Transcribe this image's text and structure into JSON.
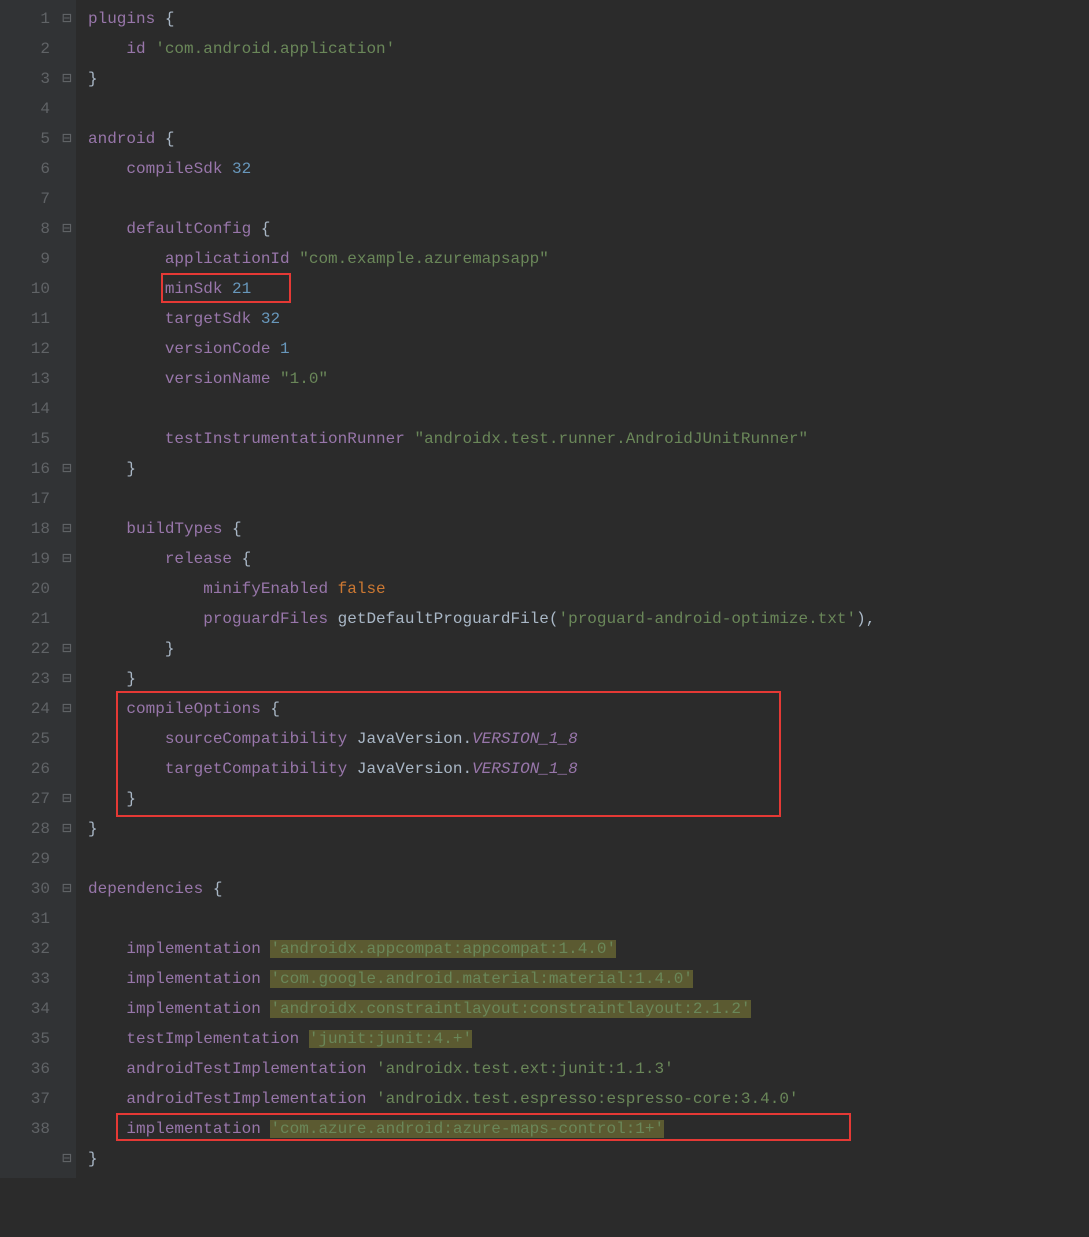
{
  "lineNumbers": [
    "1",
    "2",
    "3",
    "4",
    "5",
    "6",
    "7",
    "8",
    "9",
    "10",
    "11",
    "12",
    "13",
    "14",
    "15",
    "16",
    "17",
    "18",
    "19",
    "20",
    "21",
    "22",
    "23",
    "24",
    "25",
    "26",
    "27",
    "28",
    "29",
    "30",
    "31",
    "32",
    "33",
    "34",
    "35",
    "36",
    "37",
    "38",
    ""
  ],
  "folds": [
    "⊟",
    "",
    "⊟",
    "",
    "⊟",
    "",
    "",
    "⊟",
    "",
    "",
    "",
    "",
    "",
    "",
    "",
    "⊟",
    "",
    "⊟",
    "⊟",
    "",
    "",
    "⊟",
    "⊟",
    "⊟",
    "",
    "",
    "⊟",
    "⊟",
    "",
    "⊟",
    "",
    "",
    "",
    "",
    "",
    "",
    "",
    "",
    "⊟"
  ],
  "code": {
    "l1": {
      "m": "plugins",
      "b": " {"
    },
    "l2": {
      "indent": "    ",
      "m": "id",
      "s": " 'com.android.application'"
    },
    "l3": {
      "b": "}"
    },
    "l5": {
      "m": "android",
      "b": " {"
    },
    "l6": {
      "indent": "    ",
      "m": "compileSdk",
      "n": " 32"
    },
    "l8": {
      "indent": "    ",
      "m": "defaultConfig",
      "b": " {"
    },
    "l9": {
      "indent": "        ",
      "m": "applicationId",
      "s": " \"com.example.azuremapsapp\""
    },
    "l10": {
      "indent": "        ",
      "m": "minSdk",
      "n": " 21"
    },
    "l11": {
      "indent": "        ",
      "m": "targetSdk",
      "n": " 32"
    },
    "l12": {
      "indent": "        ",
      "m": "versionCode",
      "n": " 1"
    },
    "l13": {
      "indent": "        ",
      "m": "versionName",
      "s": " \"1.0\""
    },
    "l15": {
      "indent": "        ",
      "m": "testInstrumentationRunner",
      "s": " \"androidx.test.runner.AndroidJUnitRunner\""
    },
    "l16": {
      "indent": "    ",
      "b": "}"
    },
    "l18": {
      "indent": "    ",
      "m": "buildTypes",
      "b": " {"
    },
    "l19": {
      "indent": "        ",
      "m": "release",
      "b": " {"
    },
    "l20": {
      "indent": "            ",
      "m": "minifyEnabled",
      "k": " false"
    },
    "l21": {
      "indent": "            ",
      "m": "proguardFiles",
      "txt": " getDefaultProguardFile(",
      "s": "'proguard-android-optimize.txt'",
      "tail": "),"
    },
    "l22": {
      "indent": "        ",
      "b": "}"
    },
    "l23": {
      "indent": "    ",
      "b": "}"
    },
    "l24": {
      "indent": "    ",
      "m": "compileOptions",
      "b": " {"
    },
    "l25": {
      "indent": "        ",
      "m": "sourceCompatibility",
      "txt": " JavaVersion.",
      "i": "VERSION_1_8"
    },
    "l26": {
      "indent": "        ",
      "m": "targetCompatibility",
      "txt": " JavaVersion.",
      "i": "VERSION_1_8"
    },
    "l27": {
      "indent": "    ",
      "b": "}"
    },
    "l28": {
      "b": "}"
    },
    "l30": {
      "m": "dependencies",
      "b": " {"
    },
    "l32": {
      "indent": "    ",
      "m": "implementation",
      "sp": " ",
      "sh": "'androidx.appcompat:appcompat:1.4.0'"
    },
    "l33": {
      "indent": "    ",
      "m": "implementation",
      "sp": " ",
      "sh": "'com.google.android.material:material:1.4.0'"
    },
    "l34": {
      "indent": "    ",
      "m": "implementation",
      "sp": " ",
      "sh": "'androidx.constraintlayout:constraintlayout:2.1.2'"
    },
    "l35": {
      "indent": "    ",
      "m": "testImplementation",
      "sp": " ",
      "sh": "'junit:junit:4.+'"
    },
    "l36": {
      "indent": "    ",
      "m": "androidTestImplementation",
      "s": " 'androidx.test.ext:junit:1.1.3'"
    },
    "l37": {
      "indent": "    ",
      "m": "androidTestImplementation",
      "s": " 'androidx.test.espresso:espresso-core:3.4.0'"
    },
    "l38": {
      "indent": "    ",
      "m": "implementation",
      "sp": " ",
      "sh": "'com.azure.android:azure-maps-control:1+'"
    },
    "l39": {
      "b": "}"
    }
  }
}
